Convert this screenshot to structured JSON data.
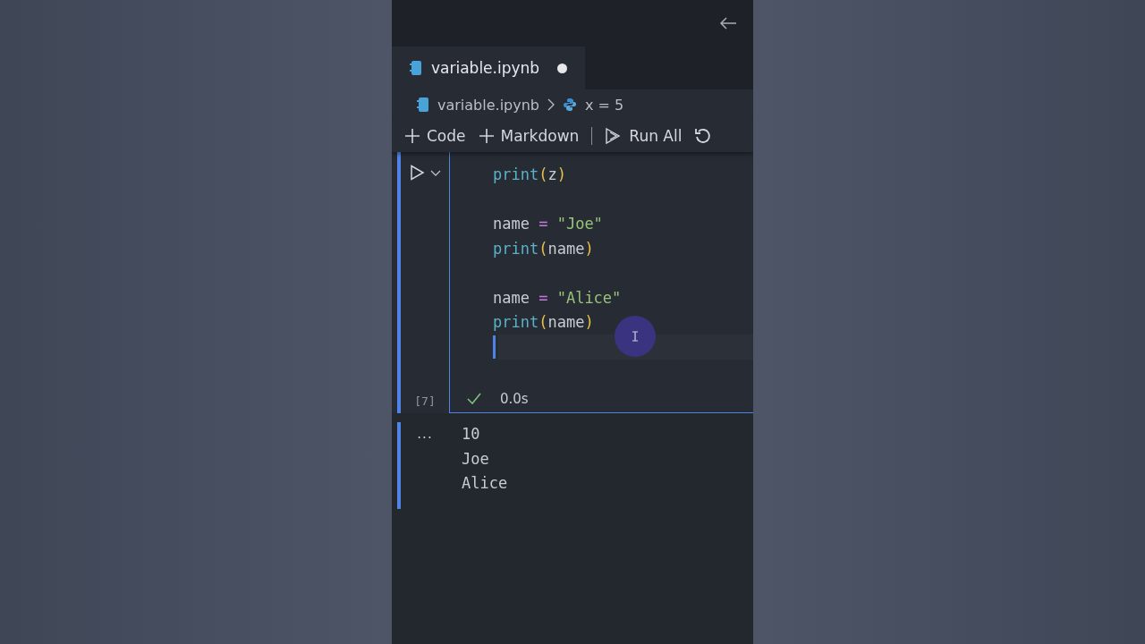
{
  "tabs": [
    {
      "label": "variable.ipynb",
      "selected": true,
      "modified": true
    }
  ],
  "breadcrumb": [
    {
      "label": "variable.ipynb",
      "kind": "notebook"
    },
    {
      "label": "x = 5",
      "kind": "python"
    }
  ],
  "toolbar": [
    {
      "label": "Code",
      "kind": "add"
    },
    {
      "label": "Markdown",
      "kind": "add"
    },
    {
      "label": "Run All",
      "kind": "run"
    },
    {
      "kind": "restart"
    }
  ],
  "cell": {
    "selected": true,
    "execution_count": "[7]",
    "success": true,
    "duration": "0.0s",
    "blocks": [
      [
        [
          {
            "text": "print",
            "kind": "func"
          },
          {
            "text": "(",
            "kind": "paren"
          },
          {
            "text": "z",
            "kind": "name"
          },
          {
            "text": ")",
            "kind": "paren"
          }
        ]
      ],
      [
        [
          {
            "text": "name",
            "kind": "name"
          },
          {
            "text": " = ",
            "kind": "op"
          },
          {
            "text": "\"Joe\"",
            "kind": "string"
          }
        ],
        [
          {
            "text": "print",
            "kind": "func"
          },
          {
            "text": "(",
            "kind": "paren"
          },
          {
            "text": "name",
            "kind": "name"
          },
          {
            "text": ")",
            "kind": "paren"
          }
        ]
      ],
      [
        [
          {
            "text": "name",
            "kind": "name"
          },
          {
            "text": " = ",
            "kind": "op"
          },
          {
            "text": "\"Alice\"",
            "kind": "string"
          }
        ],
        [
          {
            "text": "print",
            "kind": "func"
          },
          {
            "text": "(",
            "kind": "paren"
          },
          {
            "text": "name",
            "kind": "name"
          },
          {
            "text": ")",
            "kind": "paren"
          }
        ]
      ]
    ],
    "cursor_line": true,
    "output_marker": "...",
    "output": [
      "10",
      "Joe",
      "Alice"
    ]
  }
}
